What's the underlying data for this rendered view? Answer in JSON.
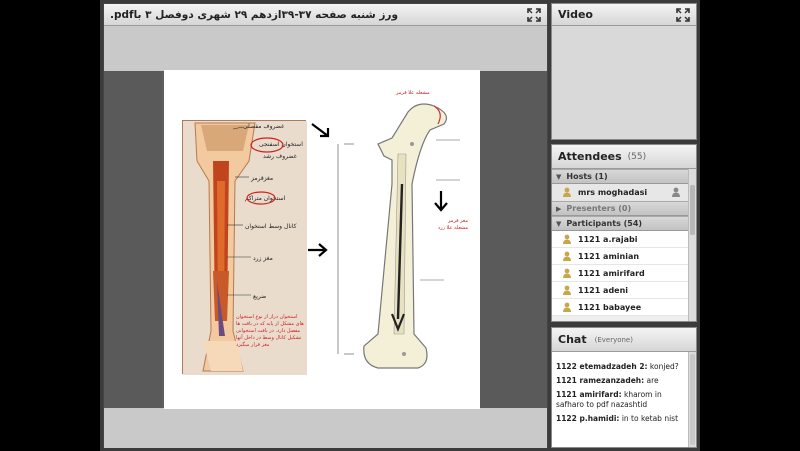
{
  "share": {
    "title": ".pdfورز شنبه صفحه ۳۷-۳۹ازدهم ۲۹ شهری دوفصل ۳ با",
    "expand_icon": "fullscreen-icon"
  },
  "document": {
    "left_labels": [
      "غضروف مفصلی",
      "استخوان اسفنجی",
      "غضروف رشد",
      "مغزقرمز",
      "استخوان متراکم",
      "کانال وسط استخوان",
      "مغز زرد",
      "ضریع"
    ],
    "red_note": "استخوان دراز از نوع استخوان های مشکل از پایه که در بافت ها مفصل دارد. در بافت استخوانی تشکیل کانال وسط در داخل آنها مغز قرار میگیرد",
    "right_top_label": "مشعله علا قرمز",
    "right_side_label": "مغز قرمز مشعله علا زرد"
  },
  "video": {
    "title": "Video",
    "expand_icon": "fullscreen-icon"
  },
  "attendees": {
    "title": "Attendees",
    "count": "(55)",
    "hosts_label": "Hosts (1)",
    "presenters_label": "Presenters (0)",
    "participants_label": "Participants (54)",
    "hosts": [
      "mrs moghadasi"
    ],
    "participants": [
      "1121 a.rajabi",
      "1121 aminian",
      "1121 amirifard",
      "1121 adeni",
      "1121 babayee"
    ]
  },
  "chat": {
    "title": "Chat",
    "scope": "(Everyone)",
    "messages": [
      {
        "sender": "1122 etemadzadeh 2:",
        "text": " konjed?"
      },
      {
        "sender": "1121 ramezanzadeh:",
        "text": " are"
      },
      {
        "sender": "1121 amirifard:",
        "text": " kharom in safharo to pdf nazashtid"
      },
      {
        "sender": "1122 p.hamidi:",
        "text": " in to ketab nist"
      }
    ]
  }
}
